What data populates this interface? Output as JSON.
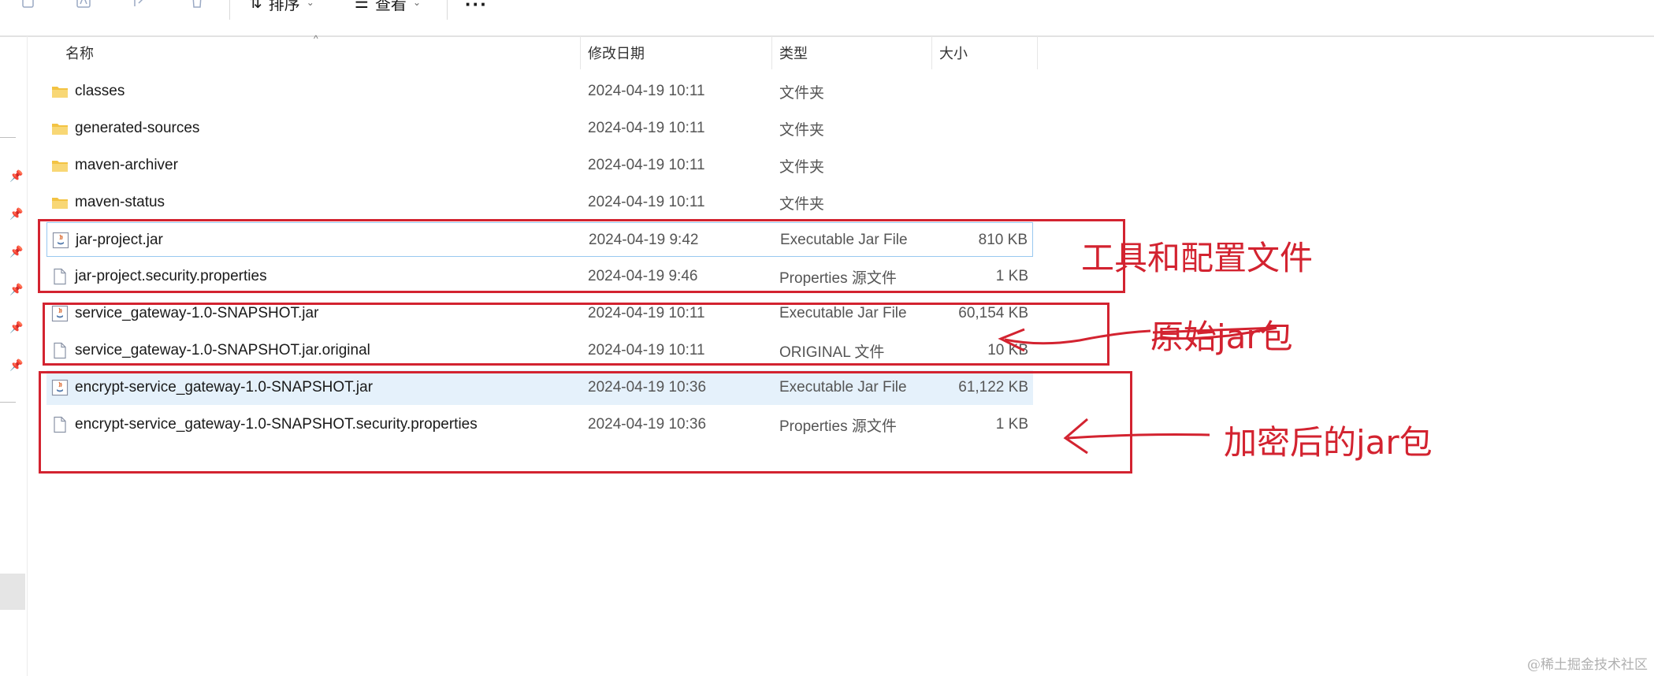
{
  "toolbar": {
    "sort_label": "排序",
    "view_label": "查看",
    "more_label": "···"
  },
  "columns": {
    "name": "名称",
    "date": "修改日期",
    "type": "类型",
    "size": "大小"
  },
  "files": [
    {
      "name": "classes",
      "date": "2024-04-19 10:11",
      "type": "文件夹",
      "size": "",
      "icon": "folder-icon"
    },
    {
      "name": "generated-sources",
      "date": "2024-04-19 10:11",
      "type": "文件夹",
      "size": "",
      "icon": "folder-icon"
    },
    {
      "name": "maven-archiver",
      "date": "2024-04-19 10:11",
      "type": "文件夹",
      "size": "",
      "icon": "folder-icon"
    },
    {
      "name": "maven-status",
      "date": "2024-04-19 10:11",
      "type": "文件夹",
      "size": "",
      "icon": "folder-icon"
    },
    {
      "name": "jar-project.jar",
      "date": "2024-04-19 9:42",
      "type": "Executable Jar File",
      "size": "810 KB",
      "icon": "jar-file-icon"
    },
    {
      "name": "jar-project.security.properties",
      "date": "2024-04-19 9:46",
      "type": "Properties 源文件",
      "size": "1 KB",
      "icon": "document-icon"
    },
    {
      "name": "service_gateway-1.0-SNAPSHOT.jar",
      "date": "2024-04-19 10:11",
      "type": "Executable Jar File",
      "size": "60,154 KB",
      "icon": "jar-file-icon"
    },
    {
      "name": "service_gateway-1.0-SNAPSHOT.jar.original",
      "date": "2024-04-19 10:11",
      "type": "ORIGINAL 文件",
      "size": "10 KB",
      "icon": "document-icon"
    },
    {
      "name": "encrypt-service_gateway-1.0-SNAPSHOT.jar",
      "date": "2024-04-19 10:36",
      "type": "Executable Jar File",
      "size": "61,122 KB",
      "icon": "jar-file-icon"
    },
    {
      "name": "encrypt-service_gateway-1.0-SNAPSHOT.security.properties",
      "date": "2024-04-19 10:36",
      "type": "Properties 源文件",
      "size": "1 KB",
      "icon": "document-icon"
    }
  ],
  "annotations": {
    "tools": "工具和配置文件",
    "original": "原始jar包",
    "encrypted": "加密后的jar包",
    "color": "#d32330"
  },
  "watermark": "@稀土掘金技术社区",
  "colors": {
    "selected_row": "#e5f1fb",
    "hover_border": "#99c8f0",
    "folder": "#f3c343"
  }
}
